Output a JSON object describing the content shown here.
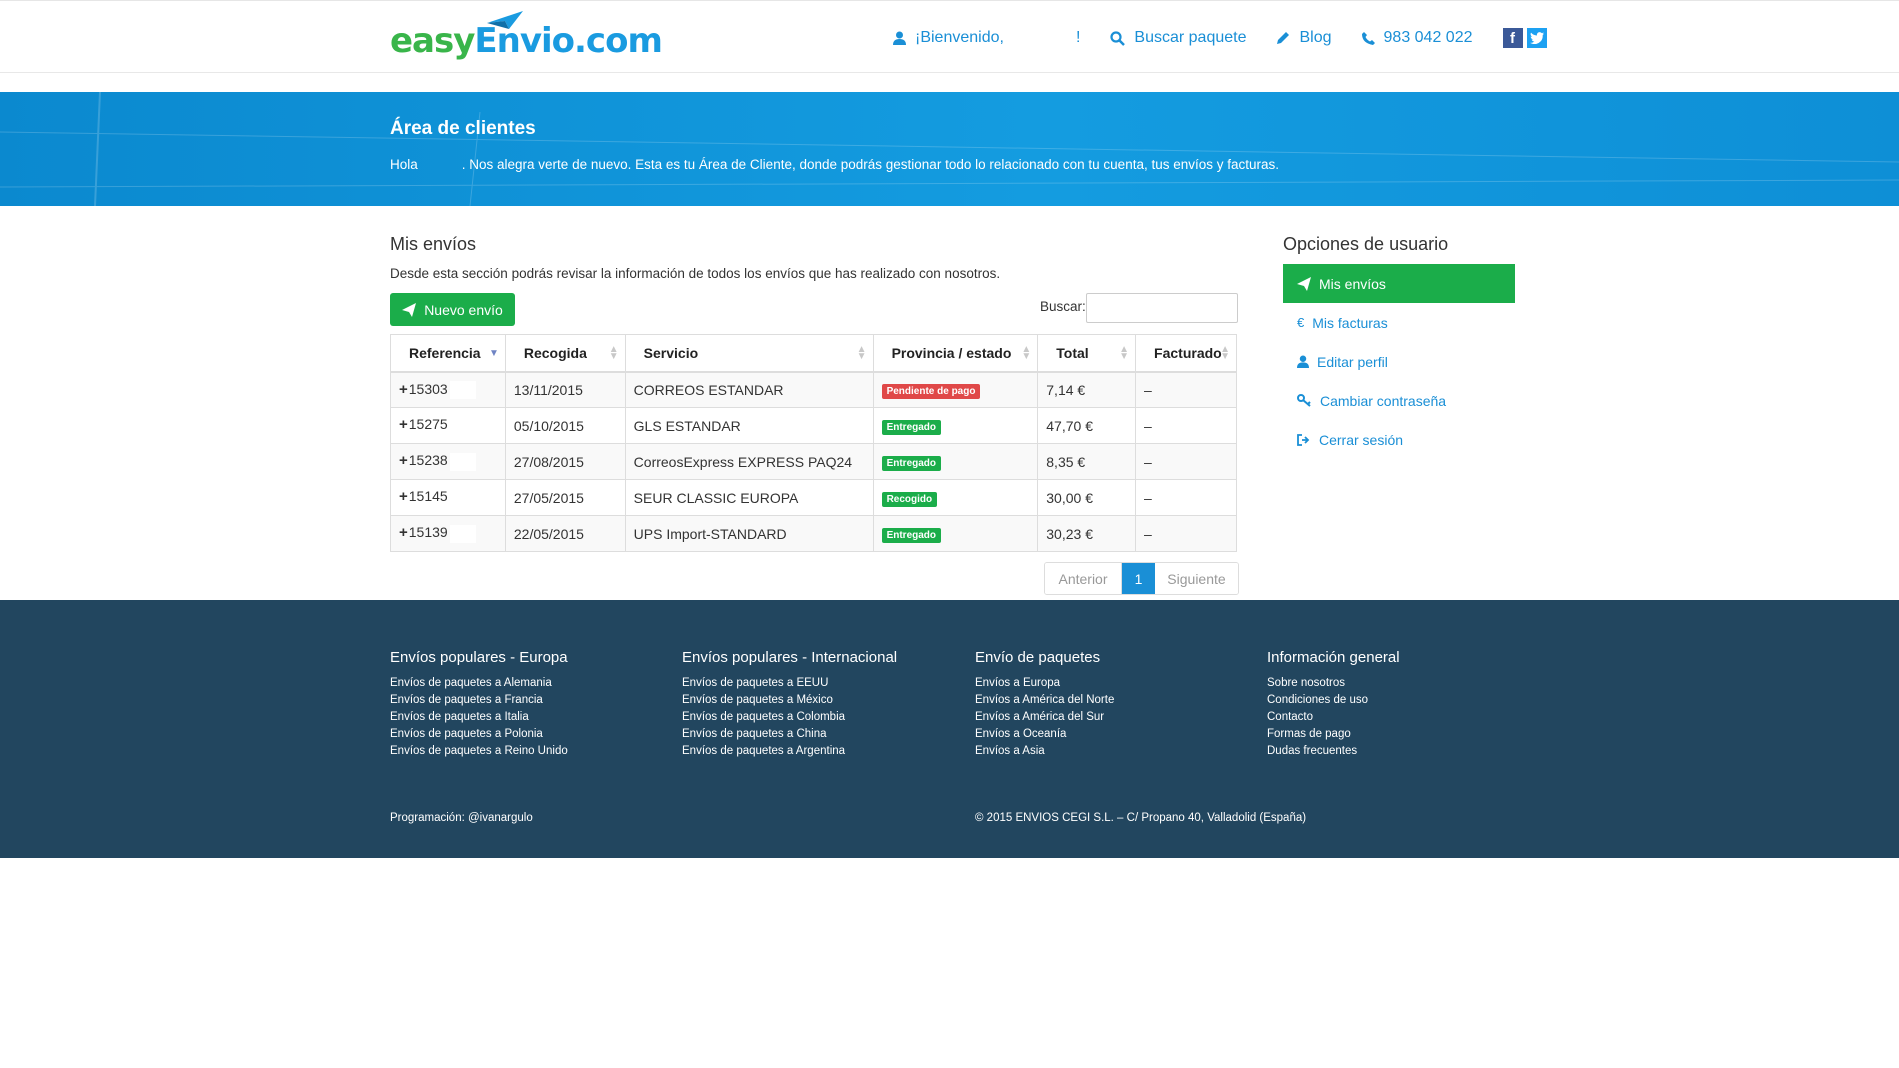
{
  "header": {
    "logo_easy": "easy",
    "logo_envio": "Envio.com",
    "welcome": "¡Bienvenido,",
    "welcome_tail": "!",
    "search_package": "Buscar paquete",
    "blog": "Blog",
    "phone": "983 042 022",
    "facebook": "f",
    "twitter": "t"
  },
  "hero": {
    "title": "Área de clientes",
    "greeting_start": "Hola",
    "greeting_text": ". Nos alegra verte de nuevo. Esta es tu Área de Cliente, donde podrás gestionar todo lo relacionado con tu cuenta, tus envíos y facturas."
  },
  "shipments": {
    "title": "Mis envíos",
    "description": "Desde esta sección podrás revisar la información de todos los envíos que has realizado con nosotros.",
    "new_button": "Nuevo envío",
    "search_label": "Buscar:",
    "columns": [
      "Referencia",
      "Recogida",
      "Servicio",
      "Provincia / estado",
      "Total",
      "Facturado"
    ],
    "rows": [
      {
        "ref": "15303",
        "date": "13/11/2015",
        "service": "CORREOS ESTANDAR",
        "status": "Pendiente de pago",
        "status_color": "#e04848",
        "total": "7,14 €",
        "billed": "–"
      },
      {
        "ref": "15275",
        "date": "05/10/2015",
        "service": "GLS ESTANDAR",
        "status": "Entregado",
        "status_color": "#1bad4a",
        "total": "47,70 €",
        "billed": "–"
      },
      {
        "ref": "15238",
        "date": "27/08/2015",
        "service": "CorreosExpress EXPRESS PAQ24",
        "status": "Entregado",
        "status_color": "#1bad4a",
        "total": "8,35 €",
        "billed": "–"
      },
      {
        "ref": "15145",
        "date": "27/05/2015",
        "service": "SEUR CLASSIC EUROPA",
        "status": "Recogido",
        "status_color": "#1bad4a",
        "total": "30,00 €",
        "billed": "–"
      },
      {
        "ref": "15139",
        "date": "22/05/2015",
        "service": "UPS Import-STANDARD",
        "status": "Entregado",
        "status_color": "#1bad4a",
        "total": "30,23 €",
        "billed": "–"
      }
    ],
    "pager": {
      "prev": "Anterior",
      "current": "1",
      "next": "Siguiente"
    }
  },
  "sidebar": {
    "title": "Opciones de usuario",
    "items": [
      {
        "label": "Mis envíos",
        "icon": "paper-plane-icon",
        "active": true
      },
      {
        "label": "Mis facturas",
        "icon": "euro-icon",
        "active": false
      },
      {
        "label": "Editar perfil",
        "icon": "user-icon",
        "active": false
      },
      {
        "label": "Cambiar contraseña",
        "icon": "key-icon",
        "active": false
      },
      {
        "label": "Cerrar sesión",
        "icon": "sign-out-icon",
        "active": false
      }
    ]
  },
  "footer": {
    "columns": [
      {
        "title": "Envíos populares - Europa",
        "links": [
          "Envíos de paquetes a Alemania",
          "Envíos de paquetes a Francia",
          "Envíos de paquetes a Italia",
          "Envíos de paquetes a Polonia",
          "Envíos de paquetes a Reino Unido"
        ]
      },
      {
        "title": "Envíos populares - Internacional",
        "links": [
          "Envíos de paquetes a EEUU",
          "Envíos de paquetes a México",
          "Envíos de paquetes a Colombia",
          "Envíos de paquetes a China",
          "Envíos de paquetes a Argentina"
        ]
      },
      {
        "title": "Envío de paquetes",
        "links": [
          "Envíos a Europa",
          "Envíos a América del Norte",
          "Envíos a América del Sur",
          "Envíos a Oceanía",
          "Envíos a Asia"
        ]
      },
      {
        "title": "Información general",
        "links": [
          "Sobre nosotros",
          "Condiciones de uso",
          "Contacto",
          "Formas de pago",
          "Dudas frecuentes"
        ]
      }
    ],
    "credit": "Programación: @ivanargulo",
    "copyright": "© 2015 ENVIOS CEGI S.L. – C/ Propano 40, Valladolid (España)"
  },
  "colors": {
    "brand_blue": "#1a8fd6",
    "brand_green": "#1bad4a",
    "footer_bg": "#22465f",
    "hero_bg": "#149ce0"
  }
}
